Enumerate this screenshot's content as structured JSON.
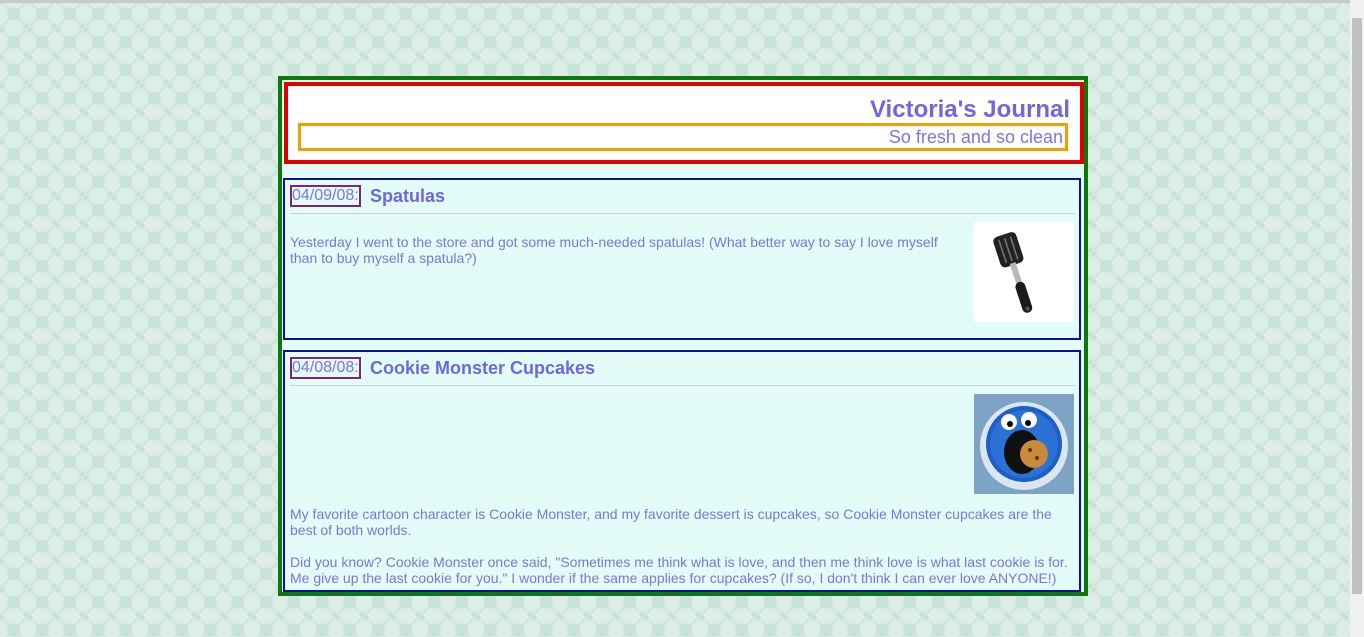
{
  "journal": {
    "title": "Victoria's Journal",
    "subtitle": "So fresh and so clean"
  },
  "posts": [
    {
      "date": "04/09/08:",
      "title": "Spatulas",
      "image_icon": "spatula-image",
      "paragraphs": [
        "Yesterday I went to the store and got some much-needed spatulas! (What better way to say I love myself than to buy myself a spatula?)"
      ]
    },
    {
      "date": "04/08/08:",
      "title": "Cookie Monster Cupcakes",
      "image_icon": "cookie-monster-cupcake-image",
      "paragraphs": [
        "My favorite cartoon character is Cookie Monster, and my favorite dessert is cupcakes, so Cookie Monster cupcakes are the best of both worlds.",
        "Did you know? Cookie Monster once said, \"Sometimes me think what is love, and then me think love is what last cookie is for. Me give up the last cookie for you.\" I wonder if the same applies for cupcakes? (If so, I don't think I can ever love ANYONE!)"
      ]
    }
  ],
  "colors": {
    "page_bg": "#dceee7",
    "container_border": "#0b7a0b",
    "header_border": "#e00000",
    "subtitle_border": "#f0a000",
    "post_border": "#1010a0",
    "date_border": "#7a2580",
    "text": "#7c74e0"
  }
}
